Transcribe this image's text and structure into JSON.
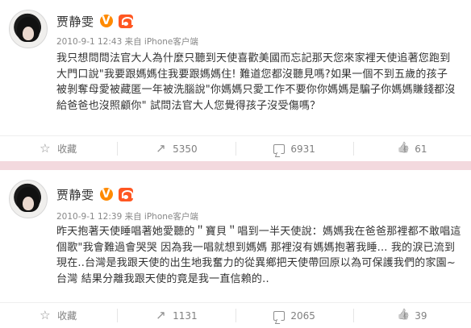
{
  "posts": [
    {
      "user": {
        "name": "贾静雯",
        "verified_badge": "V",
        "member_icon": "member-icon"
      },
      "meta": "2010-9-1 12:43 来自 iPhone客户端",
      "content": "我只想問問法官大人為什麼只聽到天使喜歡美國而忘記那天您來家裡天使追著您跑到大門口說\"我要跟媽媽住我要跟媽媽住! 難道您都沒聽見嗎?如果一個不到五歲的孩子被剝奪母愛被藏匿一年被洗腦說\"你媽媽只愛工作不要你你媽媽是騙子你媽媽賺錢都沒給爸爸也沒照顧你\" 試問法官大人您覺得孩子沒受傷嗎？",
      "actions": {
        "favorite": "收藏",
        "share": "5350",
        "comment": "6931",
        "like": "61"
      }
    },
    {
      "user": {
        "name": "贾静雯",
        "verified_badge": "V",
        "member_icon": "member-icon"
      },
      "meta": "2010-9-1 12:39 来自 iPhone客户端",
      "content": "昨天抱著天使睡唱著她愛聽的＂寶貝＂唱到一半天使說：媽媽我在爸爸那裡都不敢唱這個歌\"我會難過會哭哭 因為我一唱就想到媽媽 那裡沒有媽媽抱著我睡... 我的淚已流到現在..台灣是我跟天使的出生地我奮力的從異鄉把天使帶回原以為可保護我們的家園~台灣 結果分離我跟天使的竟是我一直信賴的..",
      "actions": {
        "favorite": "收藏",
        "share": "1131",
        "comment": "2065",
        "like": "39"
      }
    }
  ],
  "colors": {
    "divider": "#f3d9de",
    "text": "#333333",
    "muted": "#888888",
    "badge": "#ff8a00",
    "member": "#ff5722"
  }
}
